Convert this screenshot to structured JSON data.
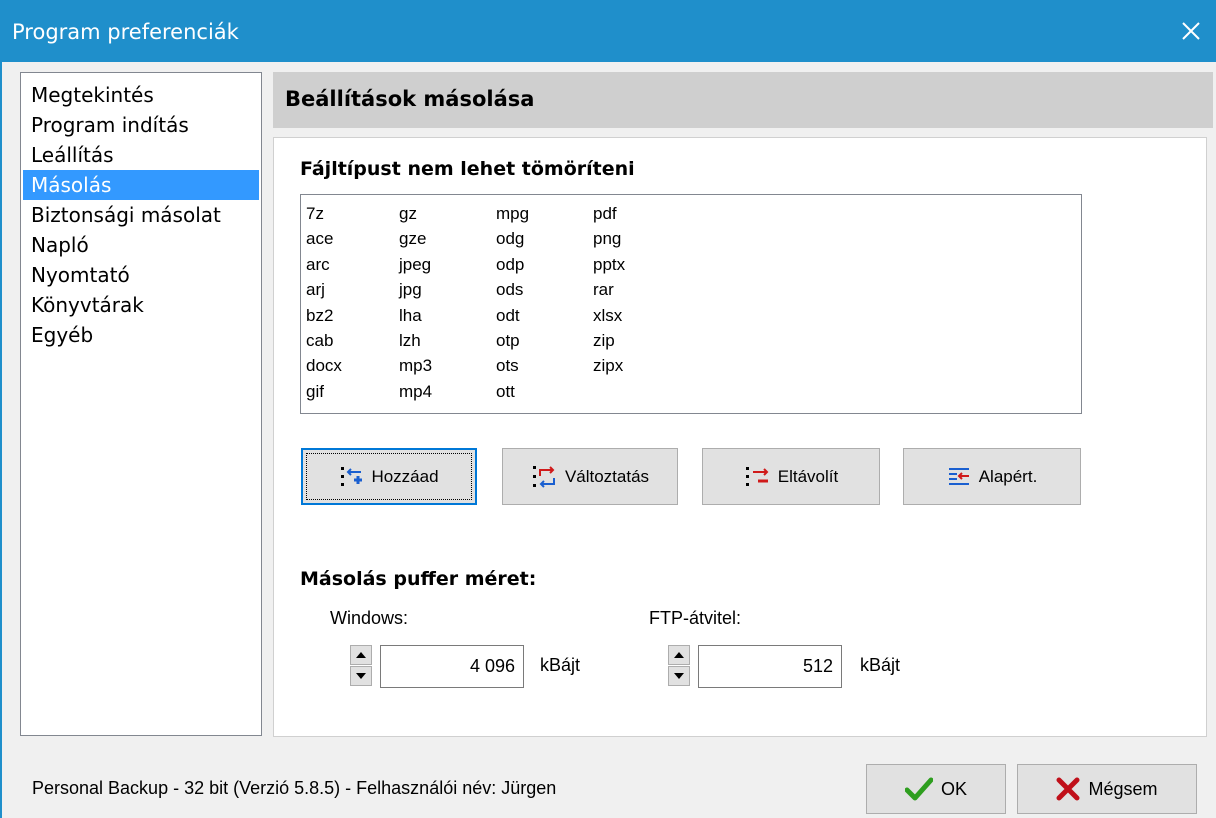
{
  "window": {
    "title": "Program preferenciák"
  },
  "sidebar": {
    "items": [
      {
        "label": "Megtekintés",
        "selected": false
      },
      {
        "label": "Program indítás",
        "selected": false
      },
      {
        "label": "Leállítás",
        "selected": false
      },
      {
        "label": "Másolás",
        "selected": true
      },
      {
        "label": "Biztonsági másolat",
        "selected": false
      },
      {
        "label": "Napló",
        "selected": false
      },
      {
        "label": "Nyomtató",
        "selected": false
      },
      {
        "label": "Könyvtárak",
        "selected": false
      },
      {
        "label": "Egyéb",
        "selected": false
      }
    ]
  },
  "main": {
    "header": "Beállítások másolása",
    "filetypes_label": "Fájltípust nem lehet tömöríteni",
    "filetypes": [
      [
        "7z",
        "ace",
        "arc",
        "arj",
        "bz2",
        "cab",
        "docx",
        "gif"
      ],
      [
        "gz",
        "gze",
        "jpeg",
        "jpg",
        "lha",
        "lzh",
        "mp3",
        "mp4"
      ],
      [
        "mpg",
        "odg",
        "odp",
        "ods",
        "odt",
        "otp",
        "ots",
        "ott"
      ],
      [
        "pdf",
        "png",
        "pptx",
        "rar",
        "xlsx",
        "zip",
        "zipx"
      ]
    ],
    "buttons": {
      "add": "Hozzáad",
      "change": "Változtatás",
      "remove": "Eltávolít",
      "default": "Alapért."
    },
    "buffer_label": "Másolás puffer méret:",
    "windows_label": "Windows:",
    "windows_value": "4 096",
    "ftp_label": "FTP-átvitel:",
    "ftp_value": "512",
    "unit": "kBájt"
  },
  "footer": {
    "status": "Personal Backup - 32 bit (Verzió 5.8.5) - Felhasználói név: Jürgen",
    "ok_label": "OK",
    "cancel_label": "Mégsem"
  },
  "colors": {
    "titlebar": "#1f8fcb",
    "selection": "#3399ff",
    "ok_check": "#2e9e1f",
    "cancel_x": "#c0101a"
  },
  "icons": {
    "close": "close-icon",
    "add": "add-item-icon",
    "change": "change-item-icon",
    "remove": "remove-item-icon",
    "default": "reset-default-icon",
    "ok": "checkmark-icon",
    "cancel": "x-icon"
  }
}
